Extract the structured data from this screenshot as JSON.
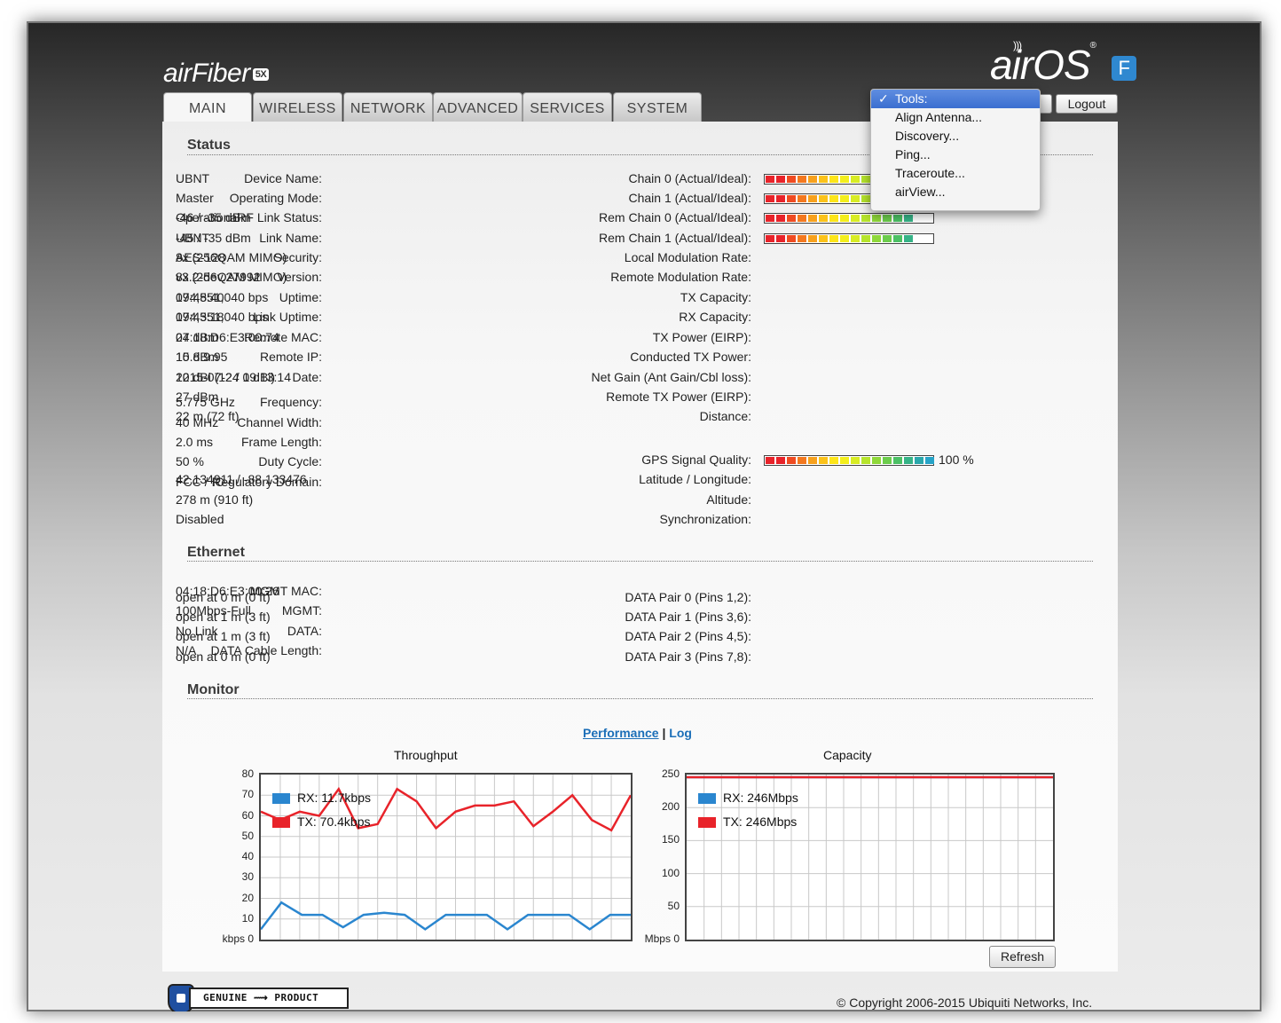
{
  "header": {
    "brand_name": "airFiber",
    "brand_badge": "5X",
    "logo_text": "airOS",
    "logo_badge": "F"
  },
  "tabs": [
    {
      "label": "MAIN",
      "active": true
    },
    {
      "label": "WIRELESS"
    },
    {
      "label": "NETWORK"
    },
    {
      "label": "ADVANCED"
    },
    {
      "label": "SERVICES"
    },
    {
      "label": "SYSTEM"
    }
  ],
  "logout_label": "Logout",
  "tools_menu": {
    "items": [
      {
        "label": "Tools:",
        "selected": true,
        "check": "✓"
      },
      {
        "label": "Align Antenna..."
      },
      {
        "label": "Discovery..."
      },
      {
        "label": "Ping..."
      },
      {
        "label": "Traceroute..."
      },
      {
        "label": "airView..."
      }
    ]
  },
  "status": {
    "title": "Status",
    "left": [
      {
        "k": "Device Name:",
        "v": "UBNT"
      },
      {
        "k": "Operating Mode:",
        "v": "Master"
      },
      {
        "k": "RF Link Status:",
        "v": "Operational"
      },
      {
        "k": "Link Name:",
        "v": "UBNT"
      },
      {
        "k": "Security:",
        "v": "AES-128"
      },
      {
        "k": "Version:",
        "v": "v3.2-dev.27992"
      },
      {
        "k": "Uptime:",
        "v": "07:48:40"
      },
      {
        "k": "Link Uptime:",
        "v": "07:43:18"
      },
      {
        "k": "Remote MAC:",
        "v": "04:18:D6:E3:00:74"
      },
      {
        "k": "Remote IP:",
        "v": "10.8.9.95"
      },
      {
        "k": "Date:",
        "v": "2015-07-24 19:13:14"
      },
      {
        "k": "Frequency:",
        "v": "5.775 GHz"
      },
      {
        "k": "Channel Width:",
        "v": "40 MHz"
      },
      {
        "k": "Frame Length:",
        "v": "2.0 ms"
      },
      {
        "k": "Duty Cycle:",
        "v": "50 %"
      },
      {
        "k": "Regulatory Domain:",
        "v": "FCC / IC"
      }
    ],
    "chains": [
      {
        "k": "Chain 0 (Actual/Ideal):",
        "v": "",
        "level": 0.62
      },
      {
        "k": "Chain 1 (Actual/Ideal):",
        "v": "",
        "level": 0.62
      },
      {
        "k": "Rem Chain 0 (Actual/Ideal):",
        "v": "-46 / -35 dBm",
        "level": 0.89
      },
      {
        "k": "Rem Chain 1 (Actual/Ideal):",
        "v": "-45 / -35 dBm",
        "level": 0.89
      }
    ],
    "right": [
      {
        "k": "Local Modulation Rate:",
        "v": "8x (256QAM MIMO)"
      },
      {
        "k": "Remote Modulation Rate:",
        "v": "8x (256QAM MIMO)"
      },
      {
        "k": "TX Capacity:",
        "v": "194,551,040 bps"
      },
      {
        "k": "RX Capacity:",
        "v": "194,551,040 bps"
      },
      {
        "k": "TX Power (EIRP):",
        "v": "27 dBm"
      },
      {
        "k": "Conducted TX Power:",
        "v": "15 dBm"
      },
      {
        "k": "Net Gain (Ant Gain/Cbl loss):",
        "v": "12 dBi (12 / 0 dBi)"
      },
      {
        "k": "Remote TX Power (EIRP):",
        "v": "27 dBm"
      },
      {
        "k": "Distance:",
        "v": "22 m (72 ft)"
      }
    ],
    "gps": {
      "k": "GPS Signal Quality:",
      "v": "100 %",
      "level": 1.0
    },
    "gps_rows": [
      {
        "k": "Latitude / Longitude:",
        "v": "42.134911 / -88.133476",
        "link": true
      },
      {
        "k": "Altitude:",
        "v": "278 m (910 ft)"
      },
      {
        "k": "Synchronization:",
        "v": "Disabled"
      }
    ]
  },
  "ethernet": {
    "title": "Ethernet",
    "left": [
      {
        "k": "MGMT MAC:",
        "v": "04:18:D6:E3:00:26"
      },
      {
        "k": "MGMT:",
        "v": "100Mbps-Full"
      },
      {
        "k": "DATA:",
        "v": "No Link"
      },
      {
        "k": "DATA Cable Length:",
        "v": "N/A"
      }
    ],
    "right": [
      {
        "k": "DATA Pair 0 (Pins 1,2):",
        "v": "open at 0 m (0 ft)"
      },
      {
        "k": "DATA Pair 1 (Pins 3,6):",
        "v": "open at 1 m (3 ft)"
      },
      {
        "k": "DATA Pair 2 (Pins 4,5):",
        "v": "open at 1 m (3 ft)"
      },
      {
        "k": "DATA Pair 3 (Pins 7,8):",
        "v": "open at 0 m (0 ft)"
      }
    ]
  },
  "monitor": {
    "title": "Monitor",
    "performance_link": "Performance",
    "separator": "|",
    "log_link": "Log",
    "refresh_label": "Refresh"
  },
  "chart_data": [
    {
      "type": "line",
      "title": "Throughput",
      "ylabel": "kbps",
      "ylim": [
        0,
        80
      ],
      "yticks": [
        "kbps 0",
        "10",
        "20",
        "30",
        "40",
        "50",
        "60",
        "70",
        "80"
      ],
      "grid": true,
      "legend_position": "top-left",
      "series": [
        {
          "name": "RX: 11.7kbps",
          "color": "#2a86cf",
          "values": [
            5,
            18,
            12,
            12,
            6,
            12,
            13,
            12,
            5,
            12,
            12,
            12,
            5,
            12,
            12,
            12,
            5,
            12,
            12
          ]
        },
        {
          "name": "TX: 70.4kbps",
          "color": "#e8232a",
          "values": [
            62,
            58,
            62,
            60,
            73,
            54,
            56,
            73,
            67,
            54,
            62,
            65,
            65,
            67,
            55,
            62,
            70,
            58,
            53,
            70
          ]
        }
      ]
    },
    {
      "type": "line",
      "title": "Capacity",
      "ylabel": "Mbps",
      "ylim": [
        0,
        250
      ],
      "yticks": [
        "Mbps 0",
        "50",
        "100",
        "150",
        "200",
        "250"
      ],
      "grid": true,
      "legend_position": "top-left",
      "series": [
        {
          "name": "RX: 246Mbps",
          "color": "#2a86cf",
          "values": [
            246,
            246
          ]
        },
        {
          "name": "TX: 246Mbps",
          "color": "#e8232a",
          "values": [
            246,
            246
          ]
        }
      ]
    }
  ],
  "footer": {
    "badge_left": "GENUINE",
    "badge_right": "PRODUCT",
    "copyright": "© Copyright 2006-2015 Ubiquiti Networks, Inc."
  }
}
